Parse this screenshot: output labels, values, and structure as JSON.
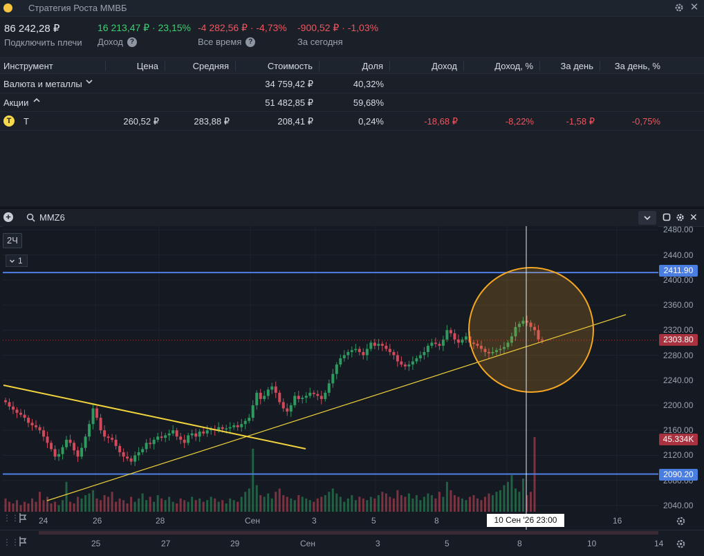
{
  "window": {
    "title": "Стратегия Роста ММВБ"
  },
  "summary": {
    "total_value": "86 242,28 ₽",
    "leverage_link": "Подключить плечи",
    "income_value": "16 213,47 ₽ · 23,15%",
    "income_label": "Доход",
    "alltime_value": "-4 282,56 ₽ · -4,73%",
    "alltime_label": "Все время",
    "today_value": "-900,52 ₽ · -1,03%",
    "today_label": "За сегодня"
  },
  "table": {
    "headers": [
      "Инструмент",
      "Цена",
      "Средняя",
      "Стоимость",
      "Доля",
      "Доход",
      "Доход, %",
      "За день",
      "За день, %"
    ],
    "groups": [
      {
        "name": "Валюта и металлы",
        "cost": "34 759,42 ₽",
        "share": "40,32%"
      },
      {
        "name": "Акции",
        "cost": "51 482,85 ₽",
        "share": "59,68%"
      }
    ],
    "rows": [
      {
        "ticker": "T",
        "logo": "Т",
        "price": "260,52 ₽",
        "avg": "283,88 ₽",
        "cost": "208,41 ₽",
        "share": "0,24%",
        "income": "-18,68 ₽",
        "income_pct": "-8,22%",
        "day": "-1,58 ₽",
        "day_pct": "-0,75%"
      }
    ]
  },
  "chart_toolbar": {
    "ticker": "MMZ6",
    "timeframe": "2Ч",
    "indicator_count": "1"
  },
  "colors": {
    "up": "#2e9a5f",
    "down": "#d1495b",
    "hline": "#4f7fe6",
    "trend": "#f2d43c",
    "circle": "#f5a623"
  },
  "chart_data": {
    "type": "candlestick",
    "y_axis_ticks": [
      "2480.00",
      "2440.00",
      "2400.00",
      "2360.00",
      "2320.00",
      "2280.00",
      "2240.00",
      "2200.00",
      "2160.00",
      "2120.00",
      "2080.00",
      "2040.00"
    ],
    "ylim": [
      2030,
      2486
    ],
    "x_axis_ticks": [
      "24",
      "26",
      "28",
      "Сен",
      "3",
      "5",
      "8",
      "10",
      "16"
    ],
    "navigator_ticks": [
      "25",
      "27",
      "29",
      "Сен",
      "3",
      "5",
      "8",
      "10",
      "14"
    ],
    "horizontal_levels": [
      "2411.90",
      "2090.20"
    ],
    "last_price": "2303.80",
    "volume_label": "45.334K",
    "crosshair_label": "10 Сен '26   23:00",
    "closes": [
      2205,
      2198,
      2193,
      2188,
      2185,
      2180,
      2172,
      2168,
      2165,
      2160,
      2150,
      2140,
      2130,
      2118,
      2122,
      2133,
      2145,
      2140,
      2128,
      2118,
      2132,
      2150,
      2170,
      2195,
      2180,
      2160,
      2150,
      2148,
      2145,
      2135,
      2125,
      2118,
      2115,
      2110,
      2120,
      2125,
      2130,
      2140,
      2138,
      2145,
      2150,
      2148,
      2152,
      2155,
      2160,
      2150,
      2145,
      2140,
      2152,
      2155,
      2150,
      2158,
      2155,
      2160,
      2162,
      2160,
      2165,
      2162,
      2163,
      2165,
      2168,
      2165,
      2170,
      2175,
      2180,
      2200,
      2220,
      2210,
      2215,
      2225,
      2230,
      2220,
      2205,
      2195,
      2190,
      2200,
      2215,
      2210,
      2212,
      2215,
      2220,
      2218,
      2215,
      2210,
      2220,
      2235,
      2250,
      2265,
      2275,
      2280,
      2285,
      2288,
      2290,
      2285,
      2280,
      2290,
      2300,
      2295,
      2298,
      2295,
      2290,
      2285,
      2280,
      2270,
      2265,
      2262,
      2265,
      2270,
      2275,
      2280,
      2285,
      2295,
      2300,
      2298,
      2295,
      2305,
      2320,
      2315,
      2305,
      2300,
      2305,
      2310,
      2300,
      2298,
      2295,
      2290,
      2285,
      2283,
      2285,
      2288,
      2290,
      2293,
      2300,
      2310,
      2325,
      2330,
      2335,
      2332,
      2325,
      2320,
      2305,
      2303.8
    ],
    "volumes": [
      8,
      6,
      5,
      7,
      4,
      6,
      5,
      8,
      6,
      12,
      7,
      9,
      5,
      6,
      4,
      7,
      18,
      6,
      5,
      9,
      8,
      10,
      11,
      13,
      8,
      7,
      10,
      9,
      12,
      6,
      8,
      7,
      5,
      9,
      6,
      8,
      11,
      7,
      9,
      6,
      10,
      8,
      7,
      9,
      6,
      5,
      8,
      7,
      6,
      9,
      7,
      8,
      6,
      7,
      9,
      8,
      6,
      7,
      5,
      8,
      7,
      6,
      9,
      12,
      14,
      38,
      16,
      10,
      9,
      11,
      8,
      12,
      14,
      10,
      9,
      8,
      7,
      10,
      9,
      8,
      7,
      6,
      8,
      9,
      10,
      12,
      14,
      11,
      9,
      6,
      8,
      10,
      7,
      9,
      8,
      7,
      9,
      8,
      10,
      12,
      11,
      9,
      8,
      13,
      10,
      9,
      11,
      8,
      10,
      7,
      9,
      11,
      10,
      8,
      12,
      9,
      18,
      13,
      10,
      9,
      8,
      7,
      9,
      10,
      8,
      7,
      9,
      11,
      10,
      12,
      13,
      16,
      18,
      22,
      14,
      12,
      20,
      10,
      12,
      45
    ]
  }
}
